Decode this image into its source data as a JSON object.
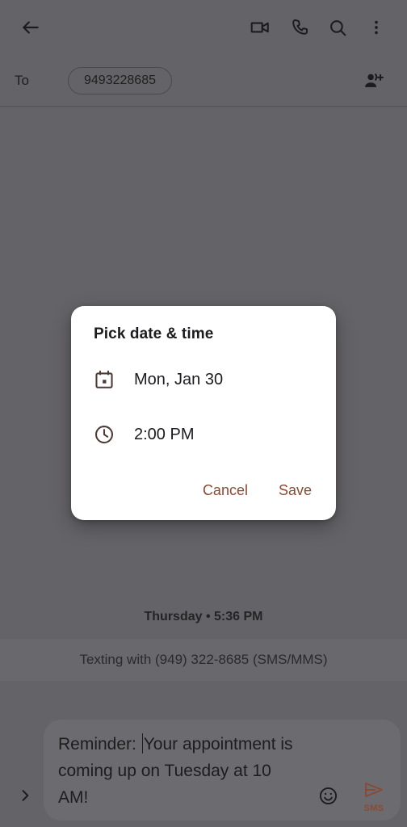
{
  "colors": {
    "scrim": "#646367",
    "dialog_surface": "#ffffff",
    "accent": "#8a4a33",
    "on_surface": "#1c1b1f"
  },
  "toolbar": {
    "back_icon": "arrow-back-icon",
    "video_icon": "videocam-icon",
    "call_icon": "phone-icon",
    "search_icon": "search-icon",
    "overflow_icon": "more-vert-icon"
  },
  "recipient_row": {
    "to_label": "To",
    "chip_value": "9493228685",
    "add_person_icon": "person-add-icon"
  },
  "thread": {
    "timestamp": "Thursday • 5:36 PM",
    "sms_banner": "Texting with (949) 322-8685 (SMS/MMS)"
  },
  "compose": {
    "expand_icon": "chevron-right-icon",
    "message_before_caret": "Reminder: ",
    "message_after_caret": "Your appointment is coming up on Tuesday at 10 AM!",
    "full_message": "Reminder: Your appointment is coming up on Tuesday at 10 AM!",
    "emoji_icon": "emoji-smile-icon",
    "send_icon": "send-icon",
    "send_label": "SMS"
  },
  "dialog": {
    "title": "Pick date & time",
    "date_icon": "calendar-icon",
    "date_value": "Mon, Jan 30",
    "time_icon": "clock-icon",
    "time_value": "2:00 PM",
    "cancel_label": "Cancel",
    "save_label": "Save"
  }
}
